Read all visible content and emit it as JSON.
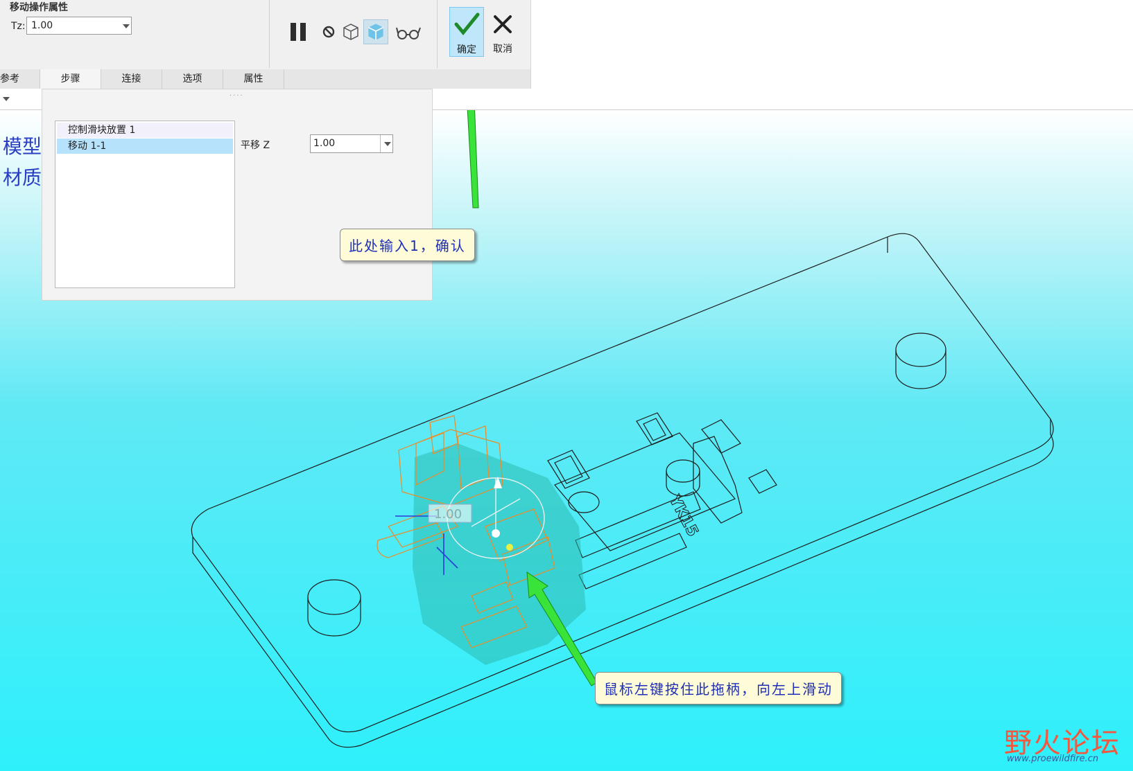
{
  "dashboard": {
    "title": "移动操作属性",
    "tz_label": "Tz:",
    "tz_value": "1.00",
    "tools": [
      "pause-icon",
      "no-icon",
      "wireframe-preview-icon",
      "shaded-preview-icon",
      "glasses-icon"
    ],
    "confirm_label": "确定",
    "cancel_label": "取消"
  },
  "tabs": [
    "参考",
    "步骤",
    "连接",
    "选项",
    "属性"
  ],
  "active_tab": "步骤",
  "steps_panel": {
    "items": [
      "控制滑块放置 1",
      "移动 1-1"
    ],
    "selected_item": "移动 1-1",
    "translate_label": "平移 Z",
    "translate_value": "1.00"
  },
  "side_links": [
    "模型",
    "材质"
  ],
  "model": {
    "drag_label": "1.00",
    "engraving": "YK15"
  },
  "callouts": {
    "input_hint": "此处输入1，确认",
    "drag_hint": "鼠标左键按住此拖柄，向左上滑动"
  },
  "watermark": {
    "name": "野火论坛",
    "url": "www.proewildfire.cn"
  },
  "colors": {
    "accent_select": "#bfe6fb",
    "callout_text": "#1f2fb5",
    "arrow_green": "#39e33a",
    "orange_edges": "#f08a24"
  }
}
